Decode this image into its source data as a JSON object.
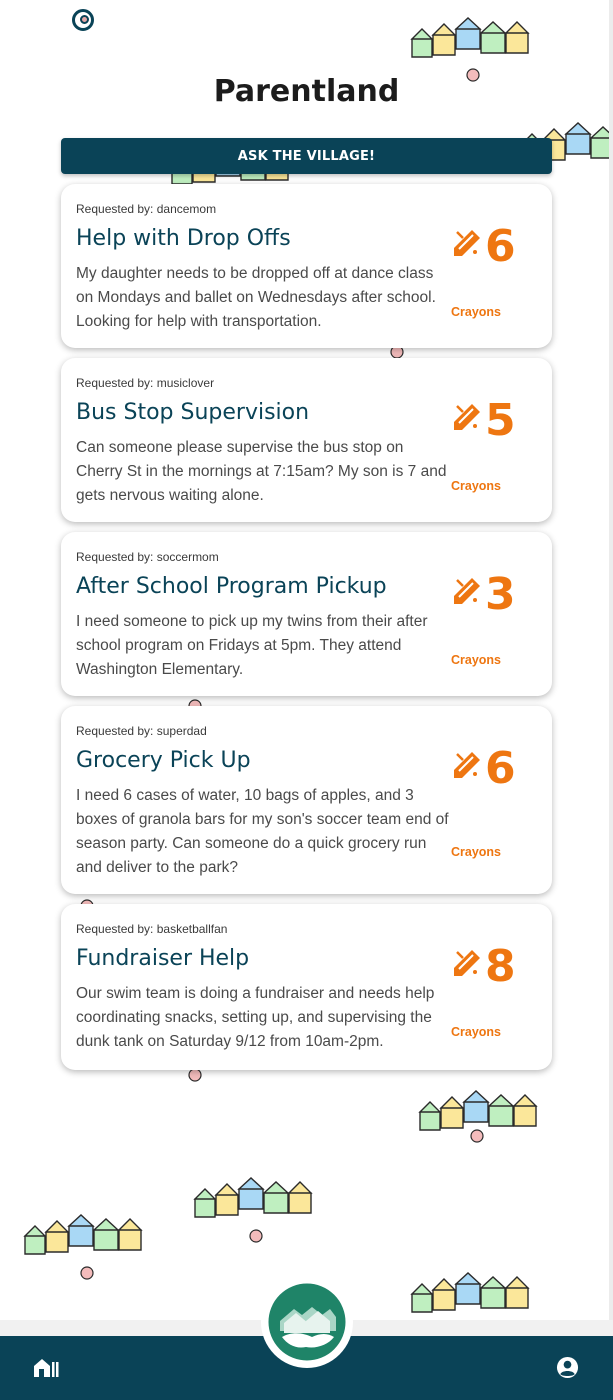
{
  "app": {
    "title": "Parentland",
    "ask_button": "ASK THE VILLAGE!"
  },
  "requests": [
    {
      "requested_by": "Requested by: dancemom",
      "title": "Help with Drop Offs",
      "description": "My daughter needs to be dropped off at dance class on Mondays and ballet on Wednesdays after school. Looking for help with transportation.",
      "crayons": "6",
      "crayons_label": "Crayons"
    },
    {
      "requested_by": "Requested by: musiclover",
      "title": "Bus Stop Supervision",
      "description": "Can someone please supervise the bus stop on Cherry St in the mornings at 7:15am? My son is 7 and gets nervous waiting alone.",
      "crayons": "5",
      "crayons_label": "Crayons"
    },
    {
      "requested_by": "Requested by: soccermom",
      "title": "After School Program Pickup",
      "description": "I need someone to pick up my twins from their after school program on Fridays at 5pm. They attend Washington Elementary.",
      "crayons": "3",
      "crayons_label": "Crayons"
    },
    {
      "requested_by": "Requested by: superdad",
      "title": "Grocery Pick Up",
      "description": "I need 6 cases of water, 10 bags of apples, and 3 boxes of granola bars for my son's soccer team end of season party. Can someone do a quick grocery run and deliver to the park?",
      "crayons": "6",
      "crayons_label": "Crayons"
    },
    {
      "requested_by": "Requested by: basketballfan",
      "title": "Fundraiser Help",
      "description": "Our swim team is doing a fundraiser and needs help coordinating snacks, setting up, and supervising the dunk tank on Saturday 9/12 from 10am-2pm.",
      "crayons": "8",
      "crayons_label": "Crayons"
    }
  ],
  "icons": {
    "top": "account-circle-icon",
    "crayon": "pencil-icon",
    "nav_home": "home-icon",
    "nav_profile": "profile-icon",
    "logo": "village-logo"
  },
  "colors": {
    "primary": "#0a4357",
    "accent": "#ee7611",
    "logo_green": "#1f8468",
    "house_green": "#bfefc0",
    "house_yellow": "#fbe79a",
    "house_blue": "#a9d8f5",
    "dot_pink": "#f4bcbc"
  }
}
